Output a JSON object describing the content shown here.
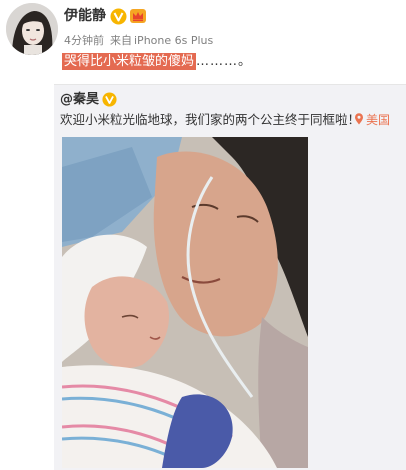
{
  "post": {
    "author": "伊能静",
    "time": "4分钟前",
    "source_prefix": "来自",
    "source": "iPhone 6s Plus",
    "text_highlight": "哭得比小米粒皱的傻妈",
    "text_trail": "………。"
  },
  "repost": {
    "author": "@秦昊",
    "text": "欢迎小米粒光临地球，我们家的两个公主终于同框啦！",
    "location": "美国"
  },
  "colors": {
    "highlight": "#e46a51",
    "verified": "#f7b500",
    "location": "#eb7350",
    "repost_bg": "#f2f2f5"
  },
  "icons": [
    "verified-badge-icon",
    "crown-icon",
    "location-pin-icon"
  ]
}
